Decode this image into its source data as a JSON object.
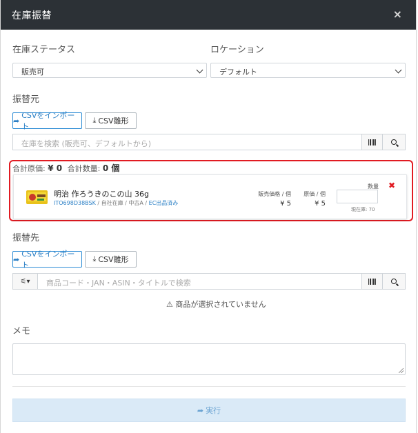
{
  "modal": {
    "title": "在庫振替",
    "close_label": "×"
  },
  "form": {
    "status_label": "在庫ステータス",
    "status_value": "販売可",
    "location_label": "ロケーション",
    "location_value": "デフォルト"
  },
  "source": {
    "heading": "振替元",
    "import_label": "CSVをインポート",
    "template_label": "CSV雛形",
    "search_placeholder": "在庫を検索 (販売可、デフォルトから)",
    "totals": {
      "cost_label": "合計原価:",
      "cost_value": "¥ 0",
      "qty_label": "合計数量:",
      "qty_value": "0 個"
    },
    "item": {
      "name": "明治 作ろうきのこの山 36g",
      "code": "ITO698D38BSK",
      "meta": " / 自社在庫 / 中古A / ",
      "listing": "EC出品済み",
      "sale_price_label": "販売価格 / 個",
      "sale_price": "¥ 5",
      "cost_label": "原価 / 個",
      "cost": "¥ 5",
      "qty_label": "数量",
      "stock_text": "現在庫: 70",
      "remove_label": "✖"
    }
  },
  "dest": {
    "heading": "振替先",
    "import_label": "CSVをインポート",
    "template_label": "CSV雛形",
    "filter_label": "⚟▾",
    "search_placeholder": "商品コード・JAN・ASIN・タイトルで検索",
    "empty_message": "商品が選択されていません"
  },
  "memo": {
    "label": "メモ"
  },
  "actions": {
    "execute_label": "実行"
  },
  "icons": {
    "share": "share-icon",
    "download": "download-icon",
    "barcode": "barcode-icon",
    "search": "search-icon",
    "warning": "warning-icon",
    "close": "close-icon"
  },
  "colors": {
    "header_bg": "#2c3136",
    "primary": "#2a8bd5",
    "highlight": "#e11b22",
    "execute_bg": "#daeaf7"
  }
}
